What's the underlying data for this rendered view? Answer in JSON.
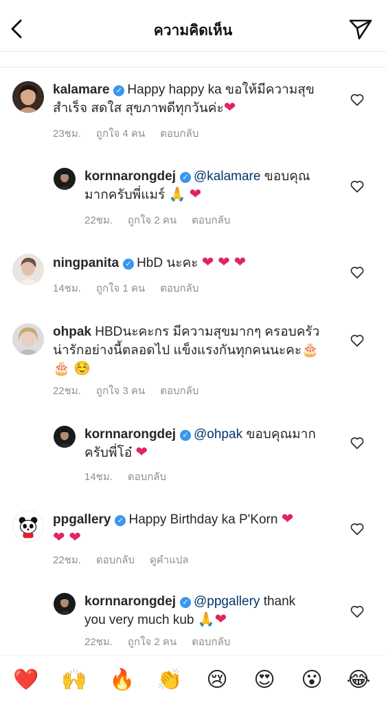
{
  "header": {
    "title": "ความคิดเห็น"
  },
  "comments": [
    {
      "username": "kalamare",
      "text": "Happy happy ka ขอให้มีความสุข",
      "text2": "สำเร็จ สดใส สุขภาพดีทุกวันค่ะ",
      "time": "23ชม.",
      "likes": "ถูกใจ 4 คน",
      "reply": "ตอบกลับ"
    },
    {
      "username": "kornnarongdej",
      "mention": "@kalamare",
      "text": " ขอบคุณ",
      "text2": "มากครับพี่แมร์ ",
      "time": "22ชม.",
      "likes": "ถูกใจ 2 คน",
      "reply": "ตอบกลับ"
    },
    {
      "username": "ningpanita",
      "text": "HbD นะคะ ",
      "time": "14ชม.",
      "likes": "ถูกใจ 1 คน",
      "reply": "ตอบกลับ"
    },
    {
      "username": "ohpak",
      "text": "HBDนะคะกร มีความสุขมากๆ ครอบครัว",
      "text2": "น่ารักอย่างนี้ตลอดไป แข็งแรงกันทุกคนนะคะ",
      "time": "22ชม.",
      "likes": "ถูกใจ 3 คน",
      "reply": "ตอบกลับ"
    },
    {
      "username": "kornnarongdej",
      "mention": "@ohpak",
      "text": " ขอบคุณมาก",
      "text2": "ครับพี่โอ๋ ",
      "time": "14ชม.",
      "reply": "ตอบกลับ"
    },
    {
      "username": "ppgallery",
      "text": "Happy Birthday ka P'Korn ",
      "time": "22ชม.",
      "reply": "ตอบกลับ",
      "translate": "ดูคำแปล"
    },
    {
      "username": "kornnarongdej",
      "mention": "@ppgallery",
      "text": " thank",
      "text2": "you very much kub ",
      "time": "22ชม.",
      "likes": "ถูกใจ 2 คน",
      "reply": "ตอบกลับ"
    }
  ],
  "emoji_bar": [
    "❤️",
    "🙌",
    "🔥",
    "👏",
    "😢",
    "😍",
    "😮",
    "😂"
  ],
  "colors": {
    "verified": "#3897f0",
    "mention": "#00376b",
    "meta": "#8e8e8e",
    "heart": "#e0245e"
  }
}
